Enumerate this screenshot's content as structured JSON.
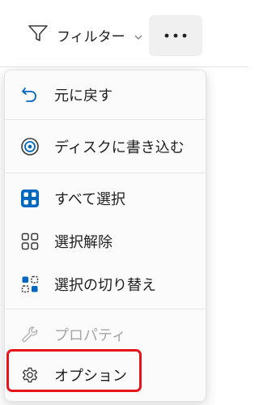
{
  "toolbar": {
    "filter_label": "フィルター",
    "filter_icon": "filter-funnel-icon",
    "more_icon": "more-horizontal-icon"
  },
  "menu": {
    "items": [
      {
        "label": "元に戻す",
        "icon": "undo-icon",
        "enabled": true
      },
      {
        "label": "ディスクに書き込む",
        "icon": "burn-disc-icon",
        "enabled": true
      },
      {
        "label": "すべて選択",
        "icon": "select-all-icon",
        "enabled": true
      },
      {
        "label": "選択解除",
        "icon": "select-none-icon",
        "enabled": true
      },
      {
        "label": "選択の切り替え",
        "icon": "invert-selection-icon",
        "enabled": true
      },
      {
        "label": "プロパティ",
        "icon": "wrench-icon",
        "enabled": false
      },
      {
        "label": "オプション",
        "icon": "gear-icon",
        "enabled": true
      }
    ]
  },
  "colors": {
    "accent": "#0067c0",
    "highlight_box": "#e8141c",
    "disabled_text": "#a6a6a6"
  }
}
